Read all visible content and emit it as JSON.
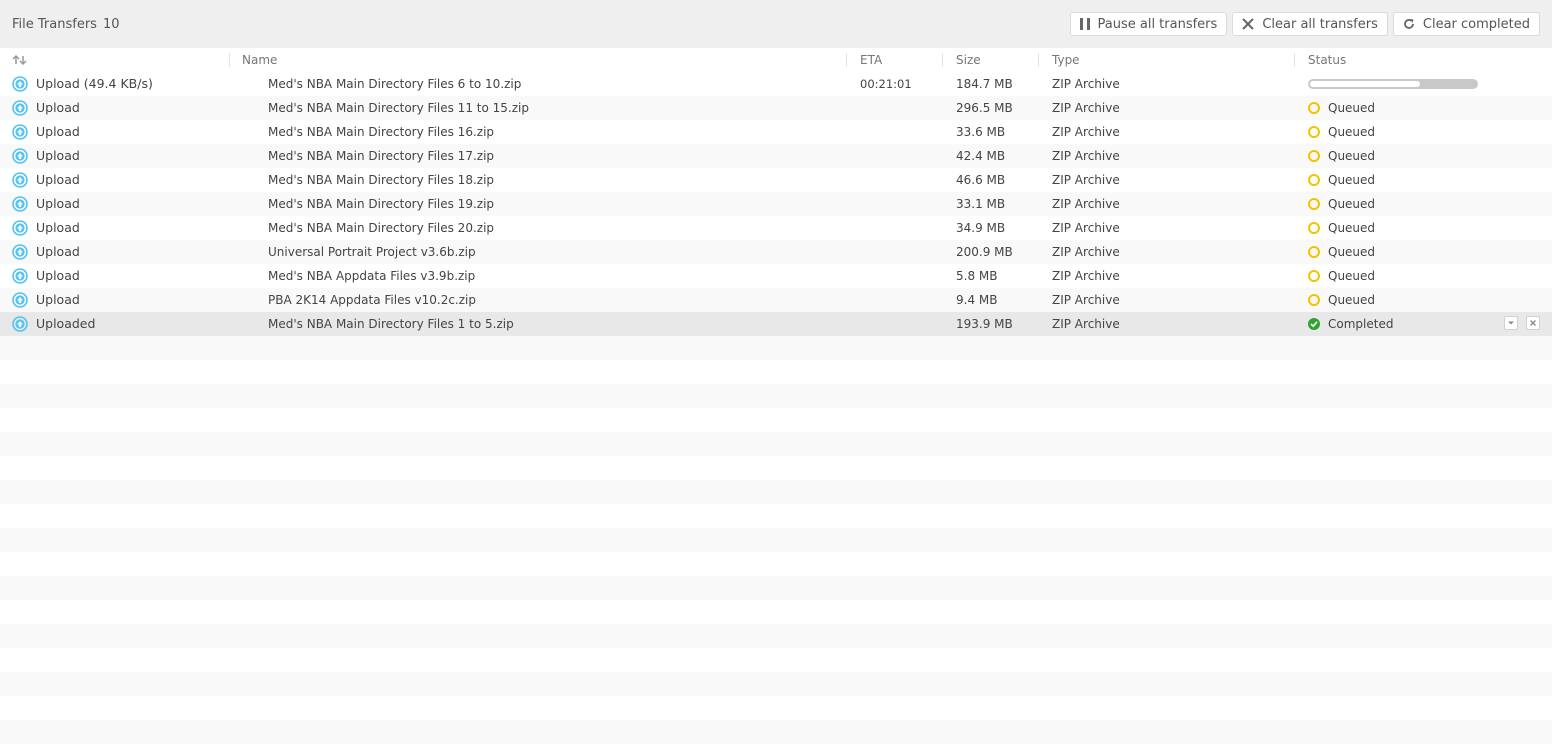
{
  "header": {
    "title": "File Transfers",
    "count": "10",
    "buttons": {
      "pause_all": "Pause all transfers",
      "clear_all": "Clear all transfers",
      "clear_completed": "Clear completed"
    }
  },
  "columns": {
    "name": "Name",
    "eta": "ETA",
    "size": "Size",
    "type": "Type",
    "status": "Status"
  },
  "colors": {
    "upload_icon": "#4fc3f7",
    "queued": "#f2c400",
    "completed": "#2ea52e"
  },
  "transfers": [
    {
      "direction": "Upload (49.4 KB/s)",
      "name": "Med's NBA Main Directory Files 6 to 10.zip",
      "eta": "00:21:01",
      "size": "184.7 MB",
      "type": "ZIP Archive",
      "status": "progress",
      "progress": 0.66
    },
    {
      "direction": "Upload",
      "name": "Med's NBA Main Directory Files 11 to 15.zip",
      "eta": "",
      "size": "296.5 MB",
      "type": "ZIP Archive",
      "status": "Queued"
    },
    {
      "direction": "Upload",
      "name": "Med's NBA Main Directory Files 16.zip",
      "eta": "",
      "size": "33.6 MB",
      "type": "ZIP Archive",
      "status": "Queued"
    },
    {
      "direction": "Upload",
      "name": "Med's NBA Main Directory Files 17.zip",
      "eta": "",
      "size": "42.4 MB",
      "type": "ZIP Archive",
      "status": "Queued"
    },
    {
      "direction": "Upload",
      "name": "Med's NBA Main Directory Files 18.zip",
      "eta": "",
      "size": "46.6 MB",
      "type": "ZIP Archive",
      "status": "Queued"
    },
    {
      "direction": "Upload",
      "name": "Med's NBA Main Directory Files 19.zip",
      "eta": "",
      "size": "33.1 MB",
      "type": "ZIP Archive",
      "status": "Queued"
    },
    {
      "direction": "Upload",
      "name": "Med's NBA Main Directory Files 20.zip",
      "eta": "",
      "size": "34.9 MB",
      "type": "ZIP Archive",
      "status": "Queued"
    },
    {
      "direction": "Upload",
      "name": "Universal Portrait Project v3.6b.zip",
      "eta": "",
      "size": "200.9 MB",
      "type": "ZIP Archive",
      "status": "Queued"
    },
    {
      "direction": "Upload",
      "name": "Med's NBA Appdata Files v3.9b.zip",
      "eta": "",
      "size": "5.8 MB",
      "type": "ZIP Archive",
      "status": "Queued"
    },
    {
      "direction": "Upload",
      "name": "PBA 2K14 Appdata Files v10.2c.zip",
      "eta": "",
      "size": "9.4 MB",
      "type": "ZIP Archive",
      "status": "Queued"
    },
    {
      "direction": "Uploaded",
      "name": "Med's NBA Main Directory Files 1 to 5.zip",
      "eta": "",
      "size": "193.9 MB",
      "type": "ZIP Archive",
      "status": "Completed"
    }
  ]
}
